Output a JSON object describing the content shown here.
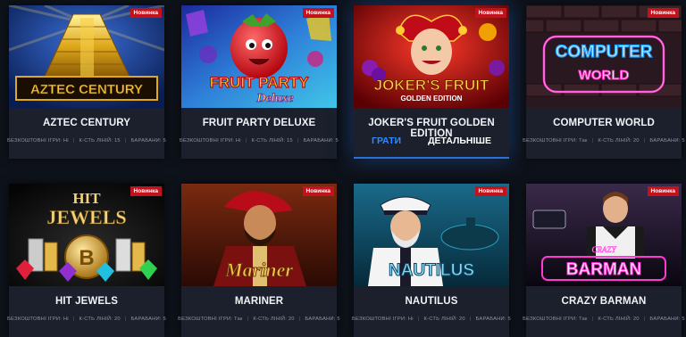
{
  "colors": {
    "background": "#0e121a",
    "card": "#1b202c",
    "badge": "#c4121d",
    "accent": "#2f8bff",
    "underline": "#2a72d8"
  },
  "games": [
    {
      "title": "AZTEC CENTURY",
      "art_text": "AZTEC CENTURY",
      "badge": "Новинка",
      "stats": [
        "БЕЗКОШТОВНІ ІГРИ: Ні",
        "К-СТЬ ЛІНІЙ: 15",
        "БАРАБАНИ: 5"
      ]
    },
    {
      "title": "FRUIT PARTY DELUXE",
      "art_text": "FRUIT PARTY",
      "art_subtext": "Deluxe",
      "badge": "Новинка",
      "stats": [
        "БЕЗКОШТОВНІ ІГРИ: Ні",
        "К-СТЬ ЛІНІЙ: 15",
        "БАРАБАНИ: 5"
      ]
    },
    {
      "title": "JOKER'S FRUIT GOLDEN EDITION",
      "art_text": "JOKER'S FRUIT",
      "art_subtext": "GOLDEN EDITION",
      "badge": "Новинка",
      "play_label": "ГРАТИ",
      "more_label": "ДЕТАЛЬНІШЕ"
    },
    {
      "title": "COMPUTER WORLD",
      "art_text": "COMPUTER",
      "art_subtext": "WORLD",
      "badge": "Новинка",
      "stats": [
        "БЕЗКОШТОВНІ ІГРИ: Так",
        "К-СТЬ ЛІНІЙ: 20",
        "БАРАБАНИ: 5"
      ]
    },
    {
      "title": "HIT JEWELS",
      "art_text": "HIT",
      "art_subtext": "JEWELS",
      "badge": "Новинка",
      "stats": [
        "БЕЗКОШТОВНІ ІГРИ: Ні",
        "К-СТЬ ЛІНІЙ: 20",
        "БАРАБАНИ: 5"
      ]
    },
    {
      "title": "MARINER",
      "art_text": "Mariner",
      "badge": "Новинка",
      "stats": [
        "БЕЗКОШТОВНІ ІГРИ: Так",
        "К-СТЬ ЛІНІЙ: 20",
        "БАРАБАНИ: 5"
      ]
    },
    {
      "title": "NAUTILUS",
      "art_text": "NAUTILUS",
      "badge": "Новинка",
      "stats": [
        "БЕЗКОШТОВНІ ІГРИ: Ні",
        "К-СТЬ ЛІНІЙ: 20",
        "БАРАБАНИ: 5"
      ]
    },
    {
      "title": "CRAZY BARMAN",
      "art_text": "BARMAN",
      "art_subtext": "CRAZY",
      "badge": "Новинка",
      "stats": [
        "БЕЗКОШТОВНІ ІГРИ: Так",
        "К-СТЬ ЛІНІЙ: 20",
        "БАРАБАНИ: 5"
      ]
    }
  ]
}
